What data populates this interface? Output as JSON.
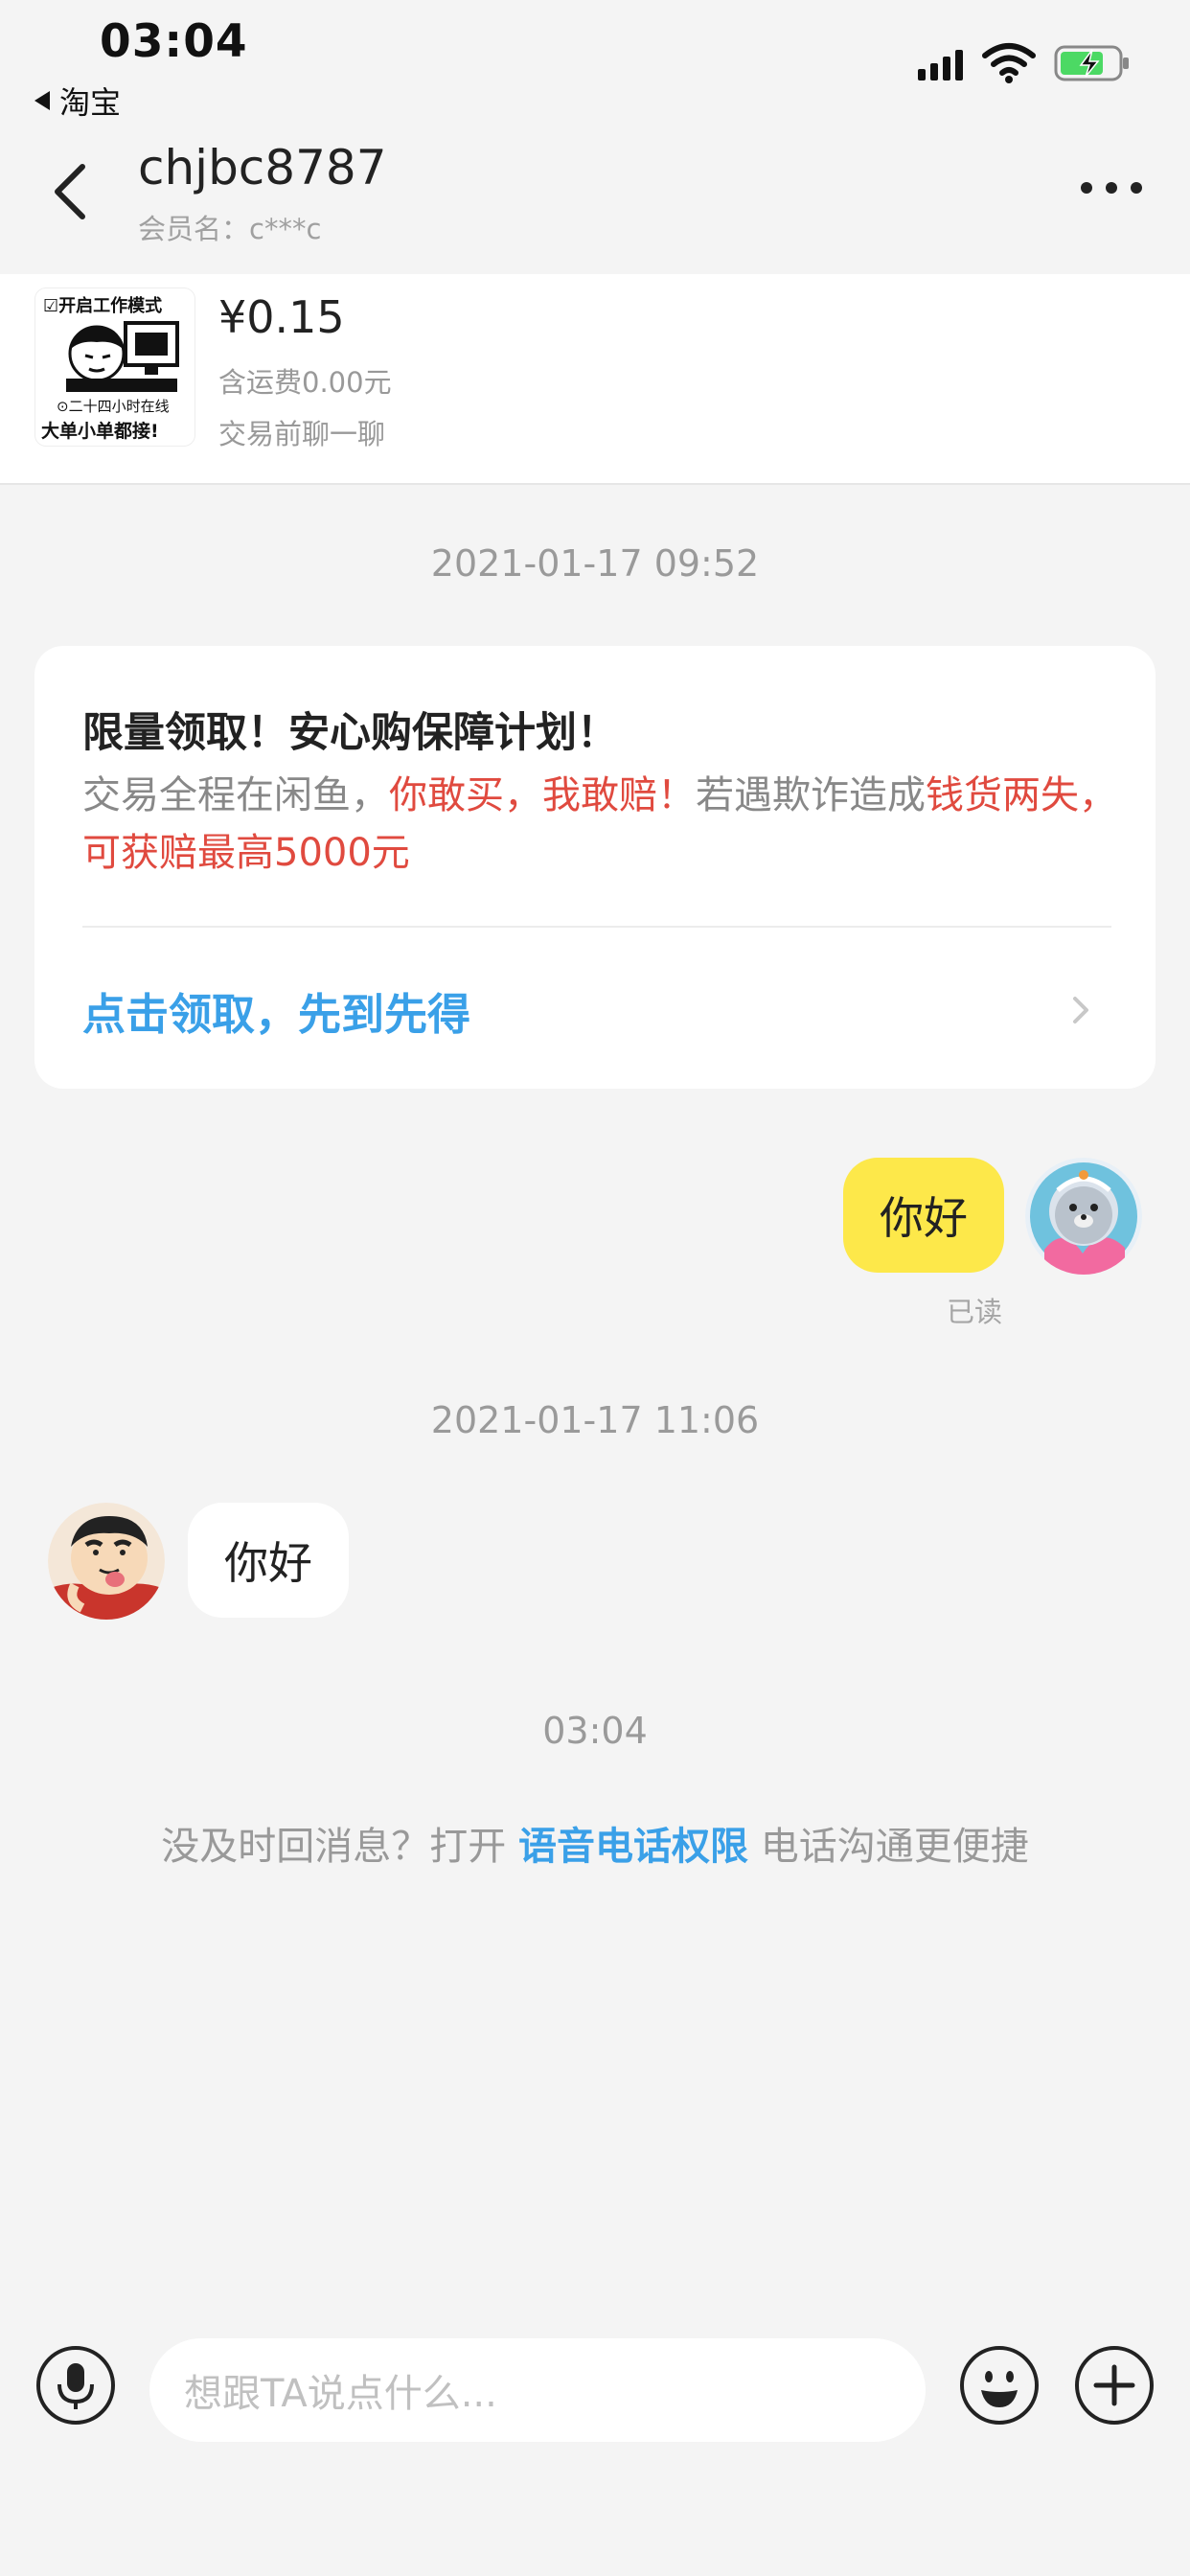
{
  "status_bar": {
    "time": "03:04",
    "back_app": "淘宝"
  },
  "header": {
    "title": "chjbc8787",
    "member_name": "会员名：c***c"
  },
  "product": {
    "thumb_top": "☑开启工作模式",
    "thumb_mid": "⊙二十四小时在线",
    "thumb_bottom": "大单小单都接!",
    "price": "¥0.15",
    "shipping": "含运费0.00元",
    "chat_hint": "交易前聊一聊"
  },
  "messages": {
    "timestamp_1": "2021-01-17 09:52",
    "promo": {
      "title": "限量领取！安心购保障计划！",
      "body_part1": "交易全程在闲鱼，",
      "body_red1": "你敢买，我敢赔！",
      "body_part2": "若遇欺诈造成",
      "body_red2": "钱货两失，可获赔最高5000元",
      "link": "点击领取，先到先得"
    },
    "my_message": "你好",
    "read_status": "已读",
    "timestamp_2": "2021-01-17 11:06",
    "other_message": "你好",
    "timestamp_3": "03:04",
    "system": {
      "part1": "没及时回消息？打开 ",
      "link": "语音电话权限",
      "part2": " 电话沟通更便捷"
    }
  },
  "input_bar": {
    "placeholder": "想跟TA说点什么..."
  }
}
